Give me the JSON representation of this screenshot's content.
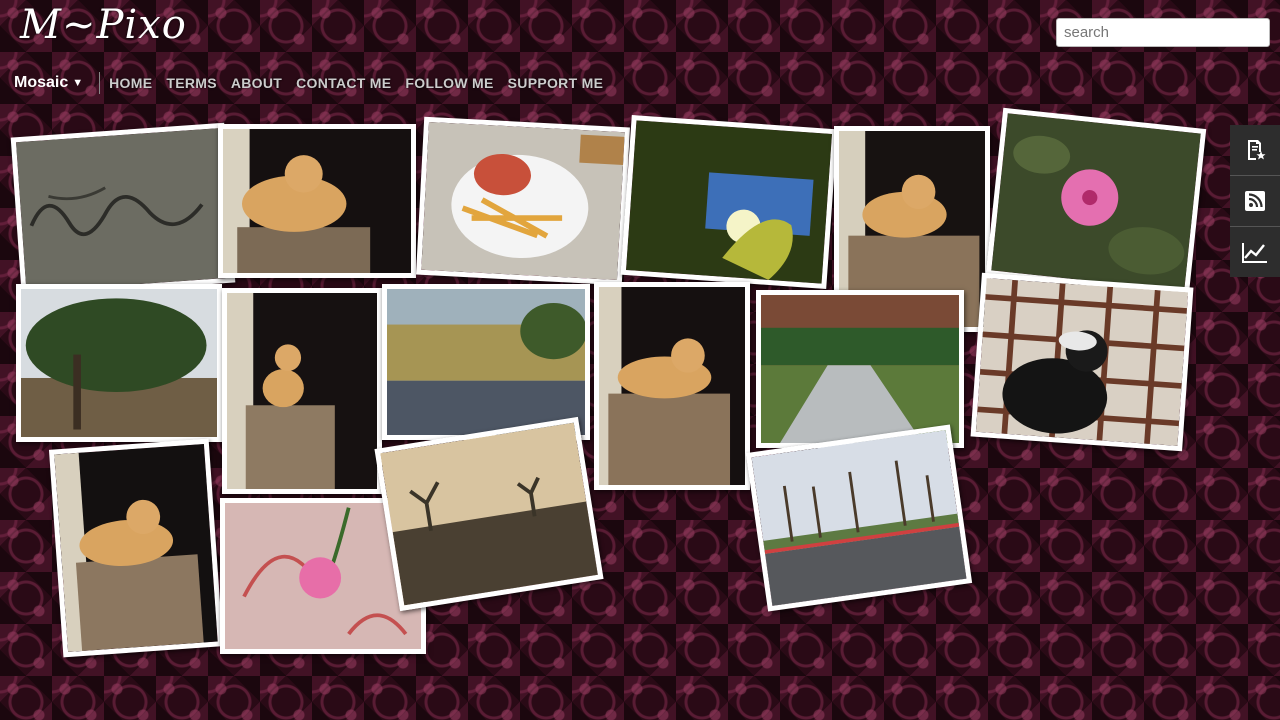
{
  "header": {
    "logo": "M~Pixo",
    "search_placeholder": "search"
  },
  "nav": {
    "view_label": "Mosaic",
    "items": [
      "HOME",
      "TERMS",
      "ABOUT",
      "CONTACT ME",
      "FOLLOW ME",
      "SUPPORT ME"
    ]
  },
  "sidebar": {
    "icons": [
      "featured-posts-icon",
      "rss-feed-icon",
      "stats-icon"
    ]
  },
  "colors": {
    "background": "#2a0a16",
    "pattern": "#8a3a5e",
    "photo_border": "#ffffff",
    "sidebar": "#2d2d2d"
  },
  "gallery": {
    "photos": [
      "sand-writing-photo",
      "orange-cat-photo",
      "fries-sandwich-photo",
      "sunlit-hand-photo",
      "orange-cat-photo",
      "pink-hibiscus-photo",
      "willow-tree-photo",
      "orange-cat-photo",
      "reed-field-photo",
      "orange-cat-photo",
      "garden-path-photo",
      "black-bird-photo",
      "orange-cat-photo",
      "hibiscus-graffiti-photo",
      "dusk-trees-photo",
      "palm-road-photo"
    ]
  }
}
